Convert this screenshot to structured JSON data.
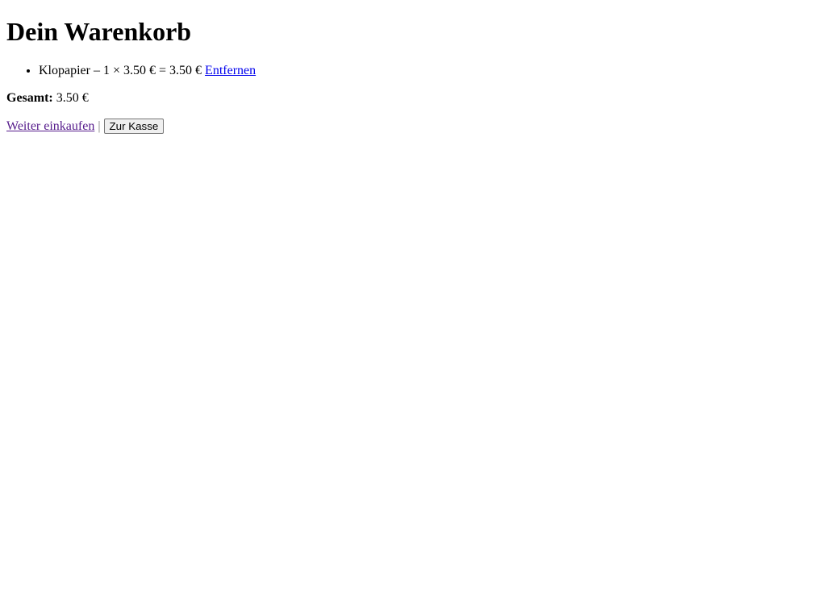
{
  "page": {
    "title": "Dein Warenkorb"
  },
  "cart": {
    "items": [
      {
        "name": "Klopapier",
        "dash": "–",
        "quantity": "1",
        "times": "×",
        "unit_price": "3.50 €",
        "equals": "=",
        "line_total": "3.50 €",
        "remove_label": "Entfernen"
      }
    ]
  },
  "summary": {
    "total_label": "Gesamt:",
    "total_value": "3.50 €"
  },
  "actions": {
    "continue_label": "Weiter einkaufen",
    "separator": "|",
    "checkout_label": "Zur Kasse"
  },
  "colors": {
    "link_unvisited": "#0000ee",
    "link_visited": "#551a8b",
    "separator": "#808080"
  }
}
